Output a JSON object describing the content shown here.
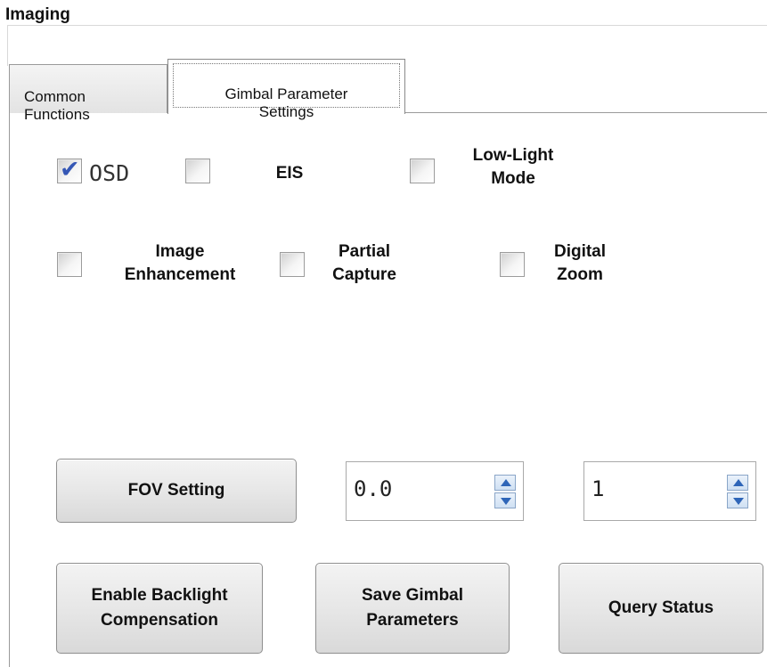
{
  "group": {
    "title": "Imaging"
  },
  "tabs": [
    {
      "label": "Common\nFunctions",
      "selected": false
    },
    {
      "label": "Gimbal Parameter\nSettings",
      "selected": true
    }
  ],
  "checkboxes": {
    "osd": {
      "label": "OSD",
      "checked": true
    },
    "eis": {
      "label": "EIS",
      "checked": false
    },
    "low_light": {
      "label": "Low-Light\nMode",
      "checked": false
    },
    "image_enhancement": {
      "label": "Image\nEnhancement",
      "checked": false
    },
    "partial_capture": {
      "label": "Partial\nCapture",
      "checked": false
    },
    "digital_zoom": {
      "label": "Digital\nZoom",
      "checked": false
    }
  },
  "fov": {
    "button_label": "FOV Setting",
    "value1": "0.0",
    "value2": "1"
  },
  "actions": {
    "backlight_label": "Enable Backlight\nCompensation",
    "save_label": "Save Gimbal\nParameters",
    "query_label": "Query Status"
  },
  "colors": {
    "check_tick": "#3557b5",
    "spin_arrow": "#2e65b8"
  }
}
